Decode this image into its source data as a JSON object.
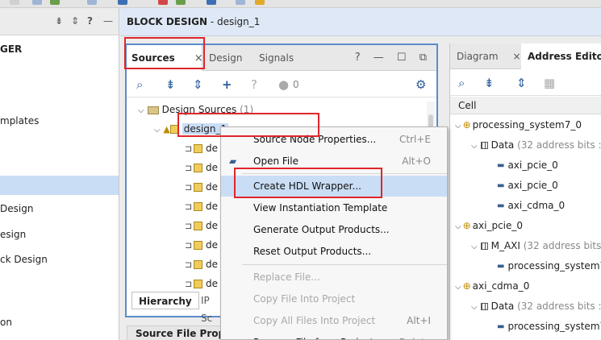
{
  "left_panel": {
    "title_fragment": "GER",
    "items": [
      "mplates",
      "Design",
      "esign",
      "ck Design",
      "on"
    ],
    "header_icons": [
      "collapse-all-icon",
      "expand-icon",
      "help-icon",
      "minimize-icon"
    ]
  },
  "block_design": {
    "label": "BLOCK DESIGN",
    "name": " - design_1"
  },
  "sources_pane": {
    "tabs": [
      {
        "label": "Sources",
        "active": true
      },
      {
        "label": "Design"
      },
      {
        "label": "Signals"
      }
    ],
    "close_glyph": "×",
    "window_icons": "? — ☐ ⧉",
    "toolbar_count": "0",
    "tree": {
      "root_label": "Design Sources",
      "root_count": " (1)",
      "selected_node": "design_1",
      "children": [
        "de",
        "de",
        "de",
        "de",
        "de",
        "de",
        "de",
        "de",
        "de"
      ]
    },
    "bottom_tabs": [
      "Hierarchy",
      "IP Sc"
    ]
  },
  "source_file_properties": "Source File Proper",
  "context_menu": {
    "items": [
      {
        "label": "Source Node Properties...",
        "shortcut": "Ctrl+E",
        "enabled": true
      },
      {
        "label": "Open File",
        "shortcut": "Alt+O",
        "enabled": true
      },
      {
        "label": "Create HDL Wrapper...",
        "shortcut": "",
        "enabled": true,
        "highlighted": true
      },
      {
        "label": "View Instantiation Template",
        "shortcut": "",
        "enabled": true
      },
      {
        "label": "Generate Output Products...",
        "shortcut": "",
        "enabled": true
      },
      {
        "label": "Reset Output Products...",
        "shortcut": "",
        "enabled": true
      },
      {
        "label": "Replace File...",
        "shortcut": "",
        "enabled": false
      },
      {
        "label": "Copy File Into Project",
        "shortcut": "",
        "enabled": false
      },
      {
        "label": "Copy All Files Into Project",
        "shortcut": "Alt+I",
        "enabled": false
      },
      {
        "label": "Remove File from Project...",
        "shortcut": "Delete",
        "enabled": true
      }
    ]
  },
  "address_editor": {
    "tabs": [
      {
        "label": "Diagram",
        "close": "×"
      },
      {
        "label": "Address Editor",
        "active": true
      }
    ],
    "column_header": "Cell",
    "rows": [
      {
        "text": "processing_system7_0"
      },
      {
        "text": "Data",
        "suffix": " (32 address bits :"
      },
      {
        "text": "axi_pcie_0"
      },
      {
        "text": "axi_pcie_0"
      },
      {
        "text": "axi_cdma_0"
      },
      {
        "text": "axi_pcie_0"
      },
      {
        "text": "M_AXI",
        "suffix": " (32 address bits"
      },
      {
        "text": "processing_system7"
      },
      {
        "text": "axi_cdma_0"
      },
      {
        "text": "Data",
        "suffix": " (32 address bits :"
      },
      {
        "text": "processing_system7"
      }
    ]
  },
  "colors": {
    "accent": "#5b8ccc",
    "annotation_red": "#e0262b",
    "selection": "#c9ddf5"
  }
}
